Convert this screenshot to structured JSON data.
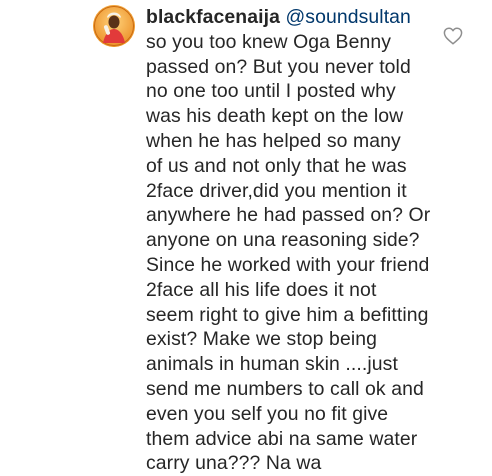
{
  "comment": {
    "username": "blackfacenaija",
    "mention": "@soundsultan",
    "lines": [
      "so you too knew Oga Benny",
      "passed on? But you never told",
      "no one too until I posted why",
      "was his death kept on the low",
      "when he has helped so many",
      "of us and not only that he was",
      "2face driver,did you mention it",
      "anywhere he had passed on? Or",
      "anyone on una reasoning side?",
      "Since he worked with your friend",
      "2face all his life does it not",
      "seem right to give him a befitting",
      "exist? Make we stop being",
      "animals in human skin ....just",
      "send me numbers to call ok and",
      "even you self  you no fit give",
      "them advice abi na same water",
      "carry una??? Na wa"
    ],
    "avatar_icon": "user-avatar",
    "like_icon": "heart-outline-icon"
  },
  "colors": {
    "text": "#262626",
    "mention": "#00376b",
    "avatar_bg": "#f5a623",
    "icon_stroke": "#8e8e8e"
  }
}
